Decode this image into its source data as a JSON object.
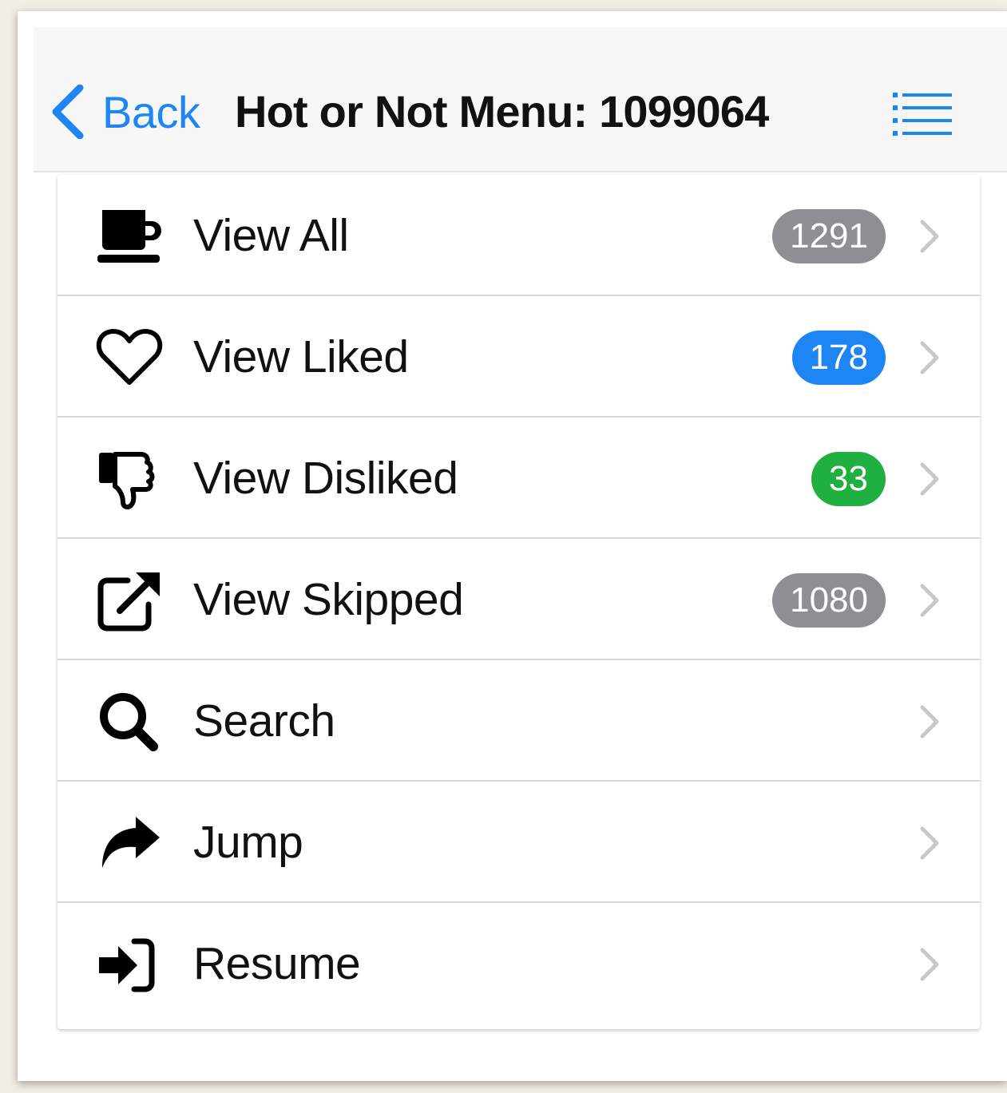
{
  "header": {
    "back_label": "Back",
    "title": "Hot or Not Menu: 1099064",
    "menu_icon": "list-icon"
  },
  "colors": {
    "accent": "#1e85f4",
    "badge_gray": "#8e8e93",
    "badge_blue": "#1e85f4",
    "badge_green": "#1fb03f"
  },
  "menu": {
    "items": [
      {
        "label": "View All",
        "icon": "coffee-cup-icon",
        "badge": "1291",
        "badge_color": "#8e8e93"
      },
      {
        "label": "View Liked",
        "icon": "heart-icon",
        "badge": "178",
        "badge_color": "#1e85f4"
      },
      {
        "label": "View Disliked",
        "icon": "thumbs-down-icon",
        "badge": "33",
        "badge_color": "#1fb03f"
      },
      {
        "label": "View Skipped",
        "icon": "external-link-icon",
        "badge": "1080",
        "badge_color": "#8e8e93"
      },
      {
        "label": "Search",
        "icon": "search-icon"
      },
      {
        "label": "Jump",
        "icon": "share-arrow-icon"
      },
      {
        "label": "Resume",
        "icon": "sign-in-icon"
      }
    ]
  }
}
